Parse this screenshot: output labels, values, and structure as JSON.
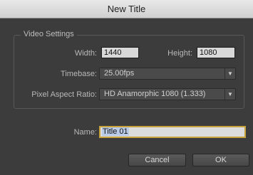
{
  "window": {
    "title": "New Title"
  },
  "video_settings": {
    "group_title": "Video Settings",
    "width_label": "Width:",
    "width_value": "1440",
    "height_label": "Height:",
    "height_value": "1080",
    "timebase_label": "Timebase:",
    "timebase_value": "25.00fps",
    "par_label": "Pixel Aspect Ratio:",
    "par_value": "HD Anamorphic 1080 (1.333)"
  },
  "name_field": {
    "label": "Name:",
    "value": "Title 01"
  },
  "buttons": {
    "cancel": "Cancel",
    "ok": "OK"
  },
  "icons": {
    "dropdown": "chevron-down-icon"
  },
  "colors": {
    "focus_ring": "#c8a23a",
    "selection": "#b9cbe6"
  }
}
